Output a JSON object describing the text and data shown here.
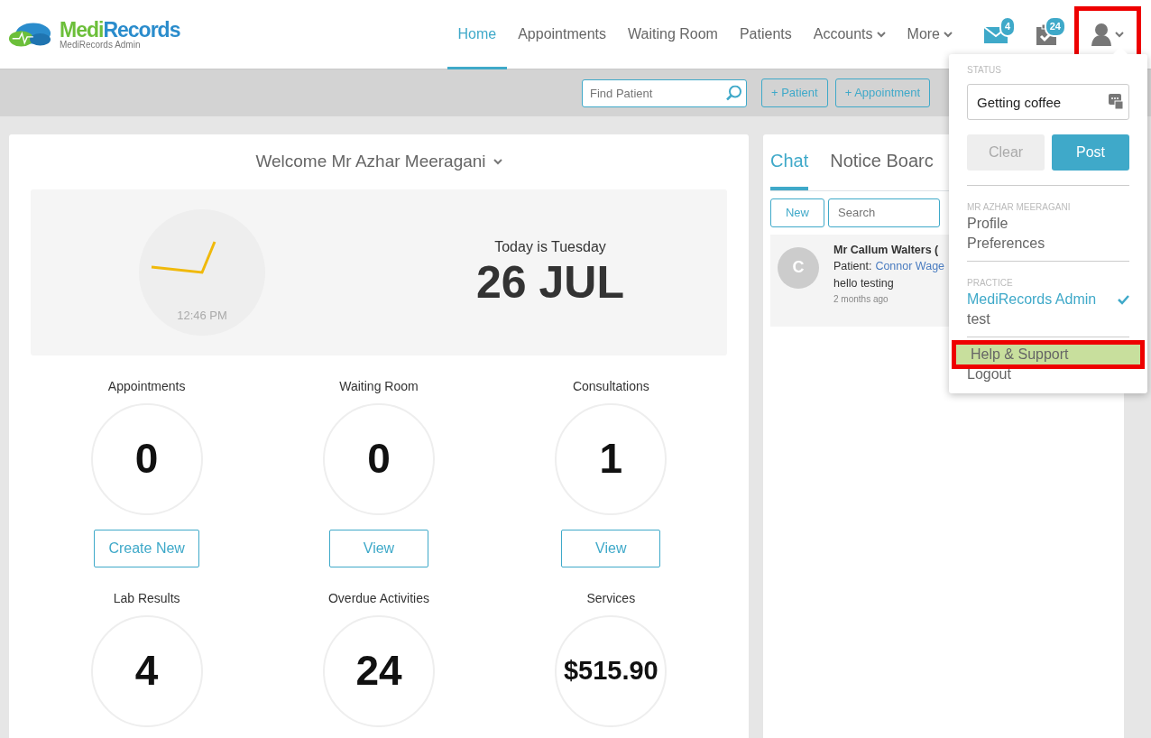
{
  "brand": {
    "name_part_1": "Medi",
    "name_part_2": "Records",
    "subtitle": "MediRecords Admin"
  },
  "nav": [
    {
      "label": "Home",
      "selected": true,
      "caret": false
    },
    {
      "label": "Appointments",
      "selected": false,
      "caret": false
    },
    {
      "label": "Waiting Room",
      "selected": false,
      "caret": false
    },
    {
      "label": "Patients",
      "selected": false,
      "caret": false
    },
    {
      "label": "Accounts",
      "selected": false,
      "caret": true
    },
    {
      "label": "More",
      "selected": false,
      "caret": true
    }
  ],
  "header_icons": [
    {
      "kind": "mail",
      "badge": "4"
    },
    {
      "kind": "tasks",
      "badge": "24"
    },
    {
      "kind": "user",
      "annotated": true
    }
  ],
  "toolbar": {
    "search": {
      "placeholder": "Find Patient"
    },
    "buttons": [
      "+ Patient",
      "+ Appointment"
    ]
  },
  "welcome": {
    "title": "Welcome Mr Azhar Meeragani",
    "time": "12:46 PM",
    "day": "Today is Tuesday",
    "date": "26 JUL"
  },
  "stats": [
    {
      "label": "Appointments",
      "value": "0",
      "button": "Create New"
    },
    {
      "label": "Waiting Room",
      "value": "0",
      "button": "View"
    },
    {
      "label": "Consultations",
      "value": "1",
      "button": "View"
    },
    {
      "label": "Lab Results",
      "value": "4"
    },
    {
      "label": "Overdue Activities",
      "value": "24"
    },
    {
      "label": "Services",
      "value": "$515.90"
    }
  ],
  "chat": {
    "tabs": [
      {
        "label": "Chat",
        "selected": true
      },
      {
        "label": "Notice Boarc",
        "selected": false
      }
    ],
    "new_button": "New",
    "search": {
      "placeholder": "Search"
    },
    "messages": [
      {
        "initial": "C",
        "sender": "Mr Callum Walters (",
        "patient_label": "Patient:",
        "patient": "Connor Wage",
        "text": "hello testing",
        "time": "2 months ago"
      }
    ]
  },
  "user_menu": {
    "status_label": "STATUS",
    "status_value": "Getting coffee",
    "clear_button": "Clear",
    "clear_disabled": true,
    "post_button": "Post",
    "sections": [
      {
        "heading": "MR AZHAR MEERAGANI",
        "items": [
          {
            "label": "Profile",
            "selected": false,
            "highlighted": false
          },
          {
            "label": "Preferences",
            "selected": false,
            "highlighted": false
          }
        ]
      },
      {
        "heading": "PRACTICE",
        "items": [
          {
            "label": "MediRecords Admin",
            "selected": true,
            "highlighted": false
          },
          {
            "label": "test",
            "selected": false,
            "highlighted": false
          }
        ]
      },
      {
        "items": [
          {
            "label": "Help & Support",
            "selected": false,
            "highlighted": true
          },
          {
            "label": "Logout",
            "selected": false,
            "highlighted": false
          }
        ]
      }
    ]
  }
}
